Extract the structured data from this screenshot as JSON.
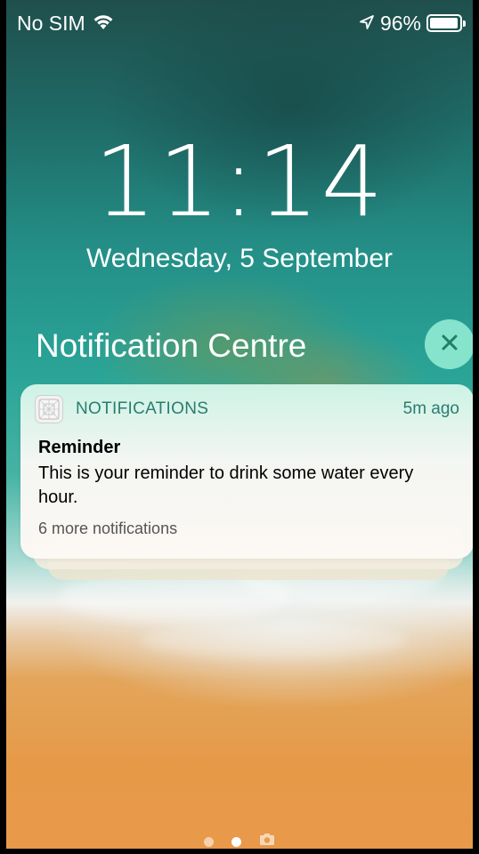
{
  "status_bar": {
    "carrier": "No SIM",
    "battery_percent": "96%",
    "battery_level": 0.96,
    "icons": [
      "wifi-icon",
      "location-arrow-icon",
      "battery-icon"
    ]
  },
  "lock_screen": {
    "time": "11:14",
    "date": "Wednesday, 5 September"
  },
  "notification_centre": {
    "title": "Notification Centre",
    "close_icon": "close-icon"
  },
  "notification": {
    "app_name": "NOTIFICATIONS",
    "time_ago": "5m ago",
    "title": "Reminder",
    "body": "This is your reminder to drink some water every hour.",
    "more": "6 more notifications",
    "stacked_count": 2
  },
  "page_indicator": {
    "pages": 3,
    "active_index": 1,
    "last_icon": "camera-icon"
  },
  "colors": {
    "accent_green": "#2a7d6e",
    "close_button": "#96f0d7"
  }
}
